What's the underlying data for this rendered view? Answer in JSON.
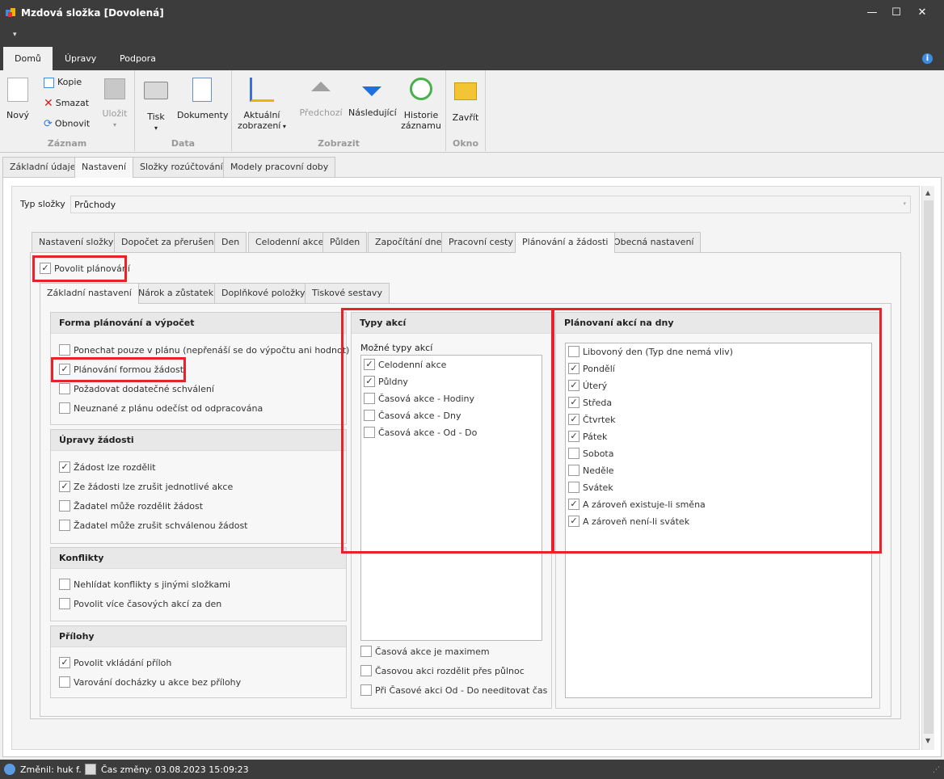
{
  "window": {
    "title": "Mzdová složka [Dovolená]"
  },
  "ribbon_tabs": [
    "Domů",
    "Úpravy",
    "Podpora"
  ],
  "ribbon": {
    "zaznam": {
      "label": "Záznam",
      "novy": "Nový",
      "kopie": "Kopie",
      "smazat": "Smazat",
      "obnovit": "Obnovit",
      "ulozit": "Uložit"
    },
    "data": {
      "label": "Data",
      "tisk": "Tisk",
      "dokumenty": "Dokumenty"
    },
    "zobrazit": {
      "label": "Zobrazit",
      "aktualni1": "Aktuální",
      "aktualni2": "zobrazení",
      "predchozi": "Předchozí",
      "nasledujici": "Následující",
      "historie1": "Historie",
      "historie2": "záznamu"
    },
    "okno": {
      "label": "Okno",
      "zavrit": "Zavřít"
    }
  },
  "main_tabs": [
    "Základní údaje",
    "Nastavení",
    "Složky rozúčtování",
    "Modely pracovní doby"
  ],
  "typ_slozky": {
    "label": "Typ složky",
    "value": "Průchody"
  },
  "sub_tabs": [
    "Nastavení složky",
    "Dopočet za přerušení",
    "Den",
    "Celodenní akce",
    "Půlden",
    "Započítání dne",
    "Pracovní cesty",
    "Plánování a žádosti",
    "Obecná nastavení"
  ],
  "povolit_planovani": {
    "label": "Povolit plánování",
    "checked": true
  },
  "inner_tabs": [
    "Základní nastavení",
    "Nárok a zůstatek",
    "Doplňkové položky",
    "Tiskové sestavy"
  ],
  "forma": {
    "title": "Forma plánování a výpočet",
    "items": [
      {
        "label": "Ponechat pouze v plánu (nepřenáší se do výpočtu ani hodnot)",
        "checked": false
      },
      {
        "label": "Plánování formou žádostí",
        "checked": true
      },
      {
        "label": "Požadovat dodatečné schválení",
        "checked": false
      },
      {
        "label": "Neuznané z plánu odečíst od odpracována",
        "checked": false
      }
    ]
  },
  "upravy": {
    "title": "Úpravy žádosti",
    "items": [
      {
        "label": "Žádost lze rozdělit",
        "checked": true
      },
      {
        "label": "Ze žádosti lze zrušit jednotlivé akce",
        "checked": true
      },
      {
        "label": "Žadatel může rozdělit žádost",
        "checked": false
      },
      {
        "label": "Žadatel může zrušit schválenou žádost",
        "checked": false
      }
    ]
  },
  "konflikty": {
    "title": "Konflikty",
    "items": [
      {
        "label": "Nehlídat konflikty s jinými složkami",
        "checked": false
      },
      {
        "label": "Povolit více časových akcí za den",
        "checked": false
      }
    ]
  },
  "prilohy": {
    "title": "Přílohy",
    "items": [
      {
        "label": "Povolit vkládání příloh",
        "checked": true
      },
      {
        "label": "Varování docházky u akce bez přílohy",
        "checked": false
      }
    ]
  },
  "typy_akci": {
    "title": "Typy akcí",
    "subtitle": "Možné typy akcí",
    "items": [
      {
        "label": "Celodenní akce",
        "checked": true
      },
      {
        "label": "Půldny",
        "checked": true
      },
      {
        "label": "Časová akce - Hodiny",
        "checked": false
      },
      {
        "label": "Časová akce - Dny",
        "checked": false
      },
      {
        "label": "Časová akce - Od - Do",
        "checked": false
      }
    ],
    "bottom": [
      {
        "label": "Časová akce je maximem",
        "checked": false
      },
      {
        "label": "Časovou akci rozdělit přes půlnoc",
        "checked": false
      },
      {
        "label": "Při Časové akci Od - Do needitovat čas",
        "checked": false
      }
    ]
  },
  "planovani_dny": {
    "title": "Plánovaní akcí na dny",
    "items": [
      {
        "label": "Libovoný den (Typ dne nemá vliv)",
        "checked": false
      },
      {
        "label": "Pondělí",
        "checked": true
      },
      {
        "label": "Úterý",
        "checked": true
      },
      {
        "label": "Středa",
        "checked": true
      },
      {
        "label": "Čtvrtek",
        "checked": true
      },
      {
        "label": "Pátek",
        "checked": true
      },
      {
        "label": "Sobota",
        "checked": false
      },
      {
        "label": "Neděle",
        "checked": false
      },
      {
        "label": "Svátek",
        "checked": false
      },
      {
        "label": "A zároveň existuje-li směna",
        "checked": true
      },
      {
        "label": "A zároveň není-li svátek",
        "checked": true
      }
    ]
  },
  "status": {
    "zmenil": "Změnil: huk f.",
    "cas": "Čas změny: 03.08.2023 15:09:23"
  },
  "colors": {
    "accent": "#1e4fd8",
    "highlight": "#e8222a",
    "chrome": "#3c3c3c"
  }
}
